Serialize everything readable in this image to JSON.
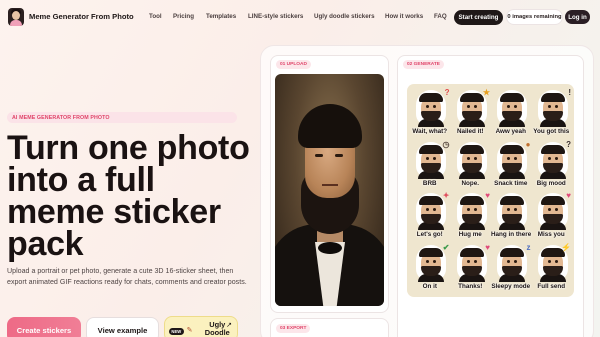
{
  "nav": {
    "brand": "Meme Generator From Photo",
    "links": [
      "Tool",
      "Pricing",
      "Templates",
      "LINE-style stickers",
      "Ugly doodle stickers",
      "How it works",
      "FAQ"
    ],
    "start_label": "Start creating",
    "remaining": "0 images remaining",
    "login_label": "Log in"
  },
  "hero": {
    "eyebrow": "AI MEME GENERATOR FROM PHOTO",
    "headline": "Turn one photo into a full meme sticker pack",
    "subtitle": "Upload a portrait or pet photo, generate a cute 3D 16-sticker sheet, then export animated GIF reactions ready for chats, comments and creator posts.",
    "cta_primary": "Create stickers",
    "cta_secondary": "View example",
    "cta_doodle_badge": "NEW",
    "cta_doodle_label": "Ugly Doodle"
  },
  "steps": {
    "upload": "01 UPLOAD",
    "generate": "02 GENERATE",
    "export": "03 EXPORT"
  },
  "stickers": [
    {
      "label": "Wait, what?",
      "deco": "?"
    },
    {
      "label": "Nailed it!",
      "deco": "★"
    },
    {
      "label": "Aww yeah",
      "deco": ""
    },
    {
      "label": "You got this",
      "deco": "!"
    },
    {
      "label": "BRB",
      "deco": "◷"
    },
    {
      "label": "Nope.",
      "deco": ""
    },
    {
      "label": "Snack time",
      "deco": "●"
    },
    {
      "label": "Big mood",
      "deco": "?"
    },
    {
      "label": "Let's go!",
      "deco": "✦"
    },
    {
      "label": "Hug me",
      "deco": "♥"
    },
    {
      "label": "Hang in there",
      "deco": ""
    },
    {
      "label": "Miss you",
      "deco": "♥"
    },
    {
      "label": "On it",
      "deco": "✔"
    },
    {
      "label": "Thanks!",
      "deco": "♥"
    },
    {
      "label": "Sleepy mode",
      "deco": "z"
    },
    {
      "label": "Full send",
      "deco": "⚡"
    }
  ],
  "colors": {
    "accent": "#ee6a86",
    "dark": "#1f1818",
    "eyebrow_text": "#e0456a"
  },
  "icons": {
    "logo": "avatar-logo-icon",
    "doodle": "pencil-doodle-icon",
    "external": "arrow-up-right-icon"
  }
}
